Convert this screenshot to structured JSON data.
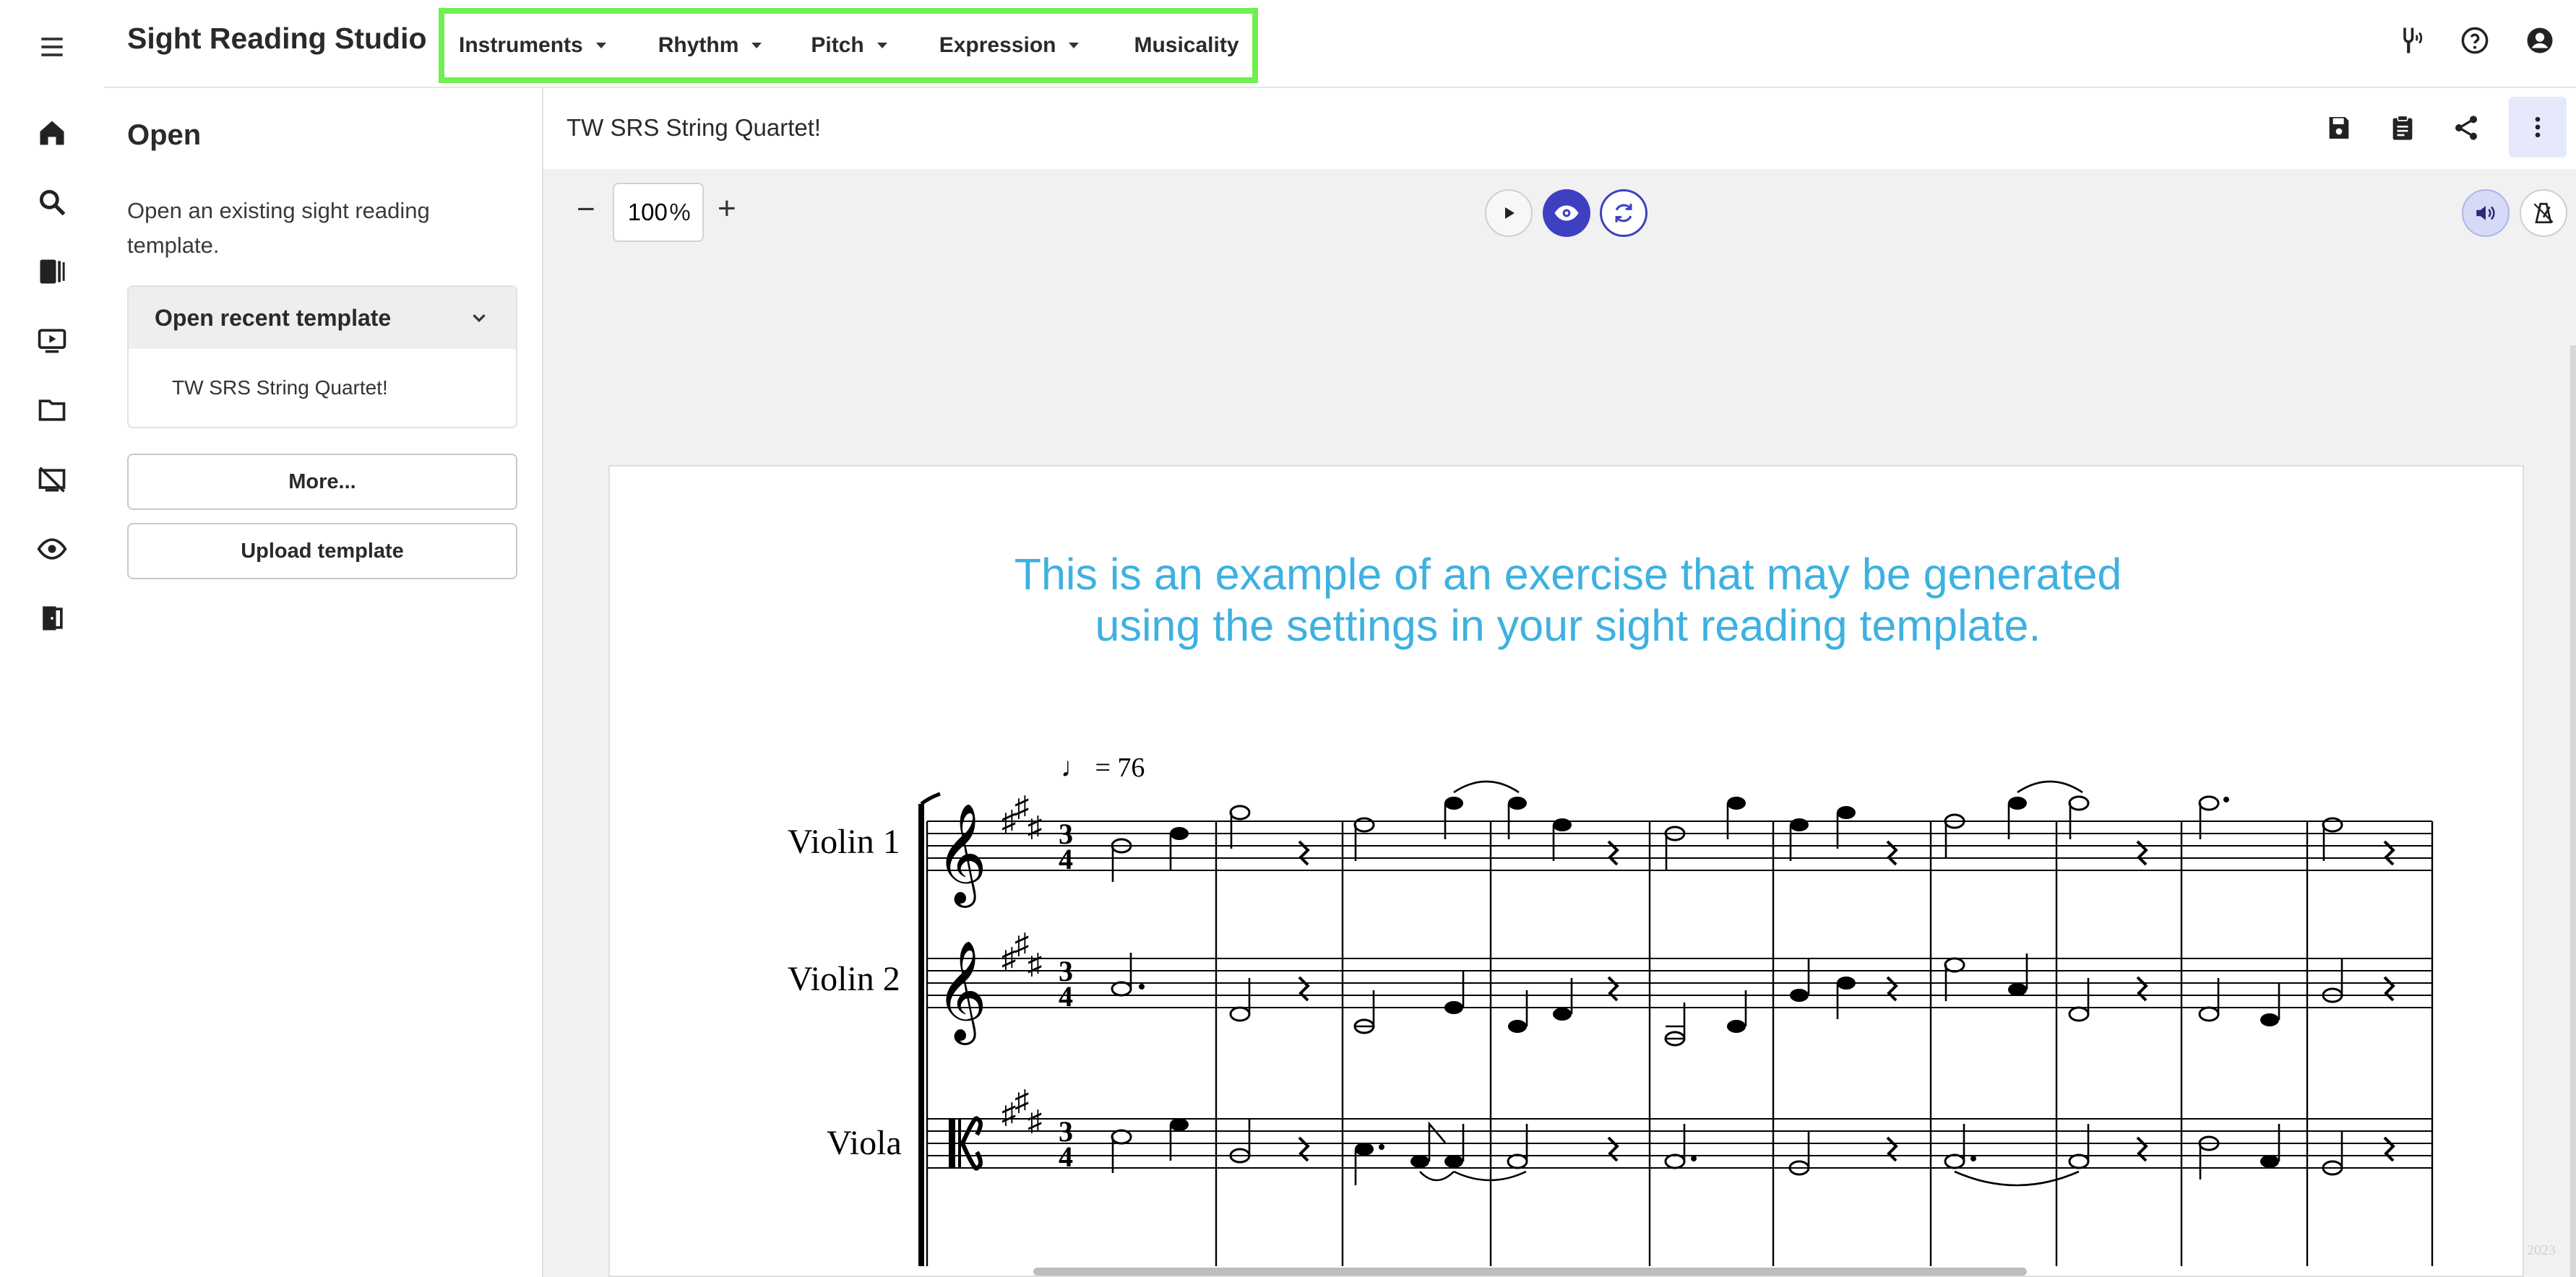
{
  "app": {
    "title": "Sight Reading Studio"
  },
  "topnav": [
    {
      "label": "Instruments",
      "has_caret": true
    },
    {
      "label": "Rhythm",
      "has_caret": true
    },
    {
      "label": "Pitch",
      "has_caret": true
    },
    {
      "label": "Expression",
      "has_caret": true
    },
    {
      "label": "Musicality",
      "has_caret": false
    }
  ],
  "topnav_highlight_color": "#6fef50",
  "header_icons": [
    "tuning-fork-icon",
    "help-icon",
    "account-icon"
  ],
  "rail_icons": [
    "menu-icon",
    "home-icon",
    "search-icon",
    "library-icon",
    "video-icon",
    "folder-icon",
    "assignment-icon",
    "ear-icon",
    "exit-icon"
  ],
  "panel": {
    "title": "Open",
    "description": "Open an existing sight reading template.",
    "recent": {
      "heading": "Open recent template",
      "items": [
        "TW SRS String Quartet!"
      ]
    },
    "more_label": "More...",
    "upload_label": "Upload template"
  },
  "document": {
    "title": "TW SRS String Quartet!",
    "actions": [
      "save-icon",
      "clipboard-icon",
      "share-icon",
      "more-vert-icon"
    ]
  },
  "toolbar": {
    "zoom_value": "100",
    "zoom_unit": "%",
    "minus_label": "−",
    "plus_label": "+",
    "playback_controls": [
      "play-icon",
      "eye-icon",
      "regenerate-icon"
    ],
    "right_controls": [
      "volume-icon",
      "metronome-icon"
    ],
    "accent_color": "#3f3fc2"
  },
  "score": {
    "caption_line1": "This is an example of an exercise that may be generated",
    "caption_line2": "using the settings in your sight reading template.",
    "caption_color": "#3eb1e0",
    "tempo_mark": "♩ = 76",
    "time_signature": "3/4",
    "key_signature": "3 sharps",
    "instruments": [
      "Violin 1",
      "Violin 2",
      "Viola"
    ],
    "year_mark": "2023"
  }
}
